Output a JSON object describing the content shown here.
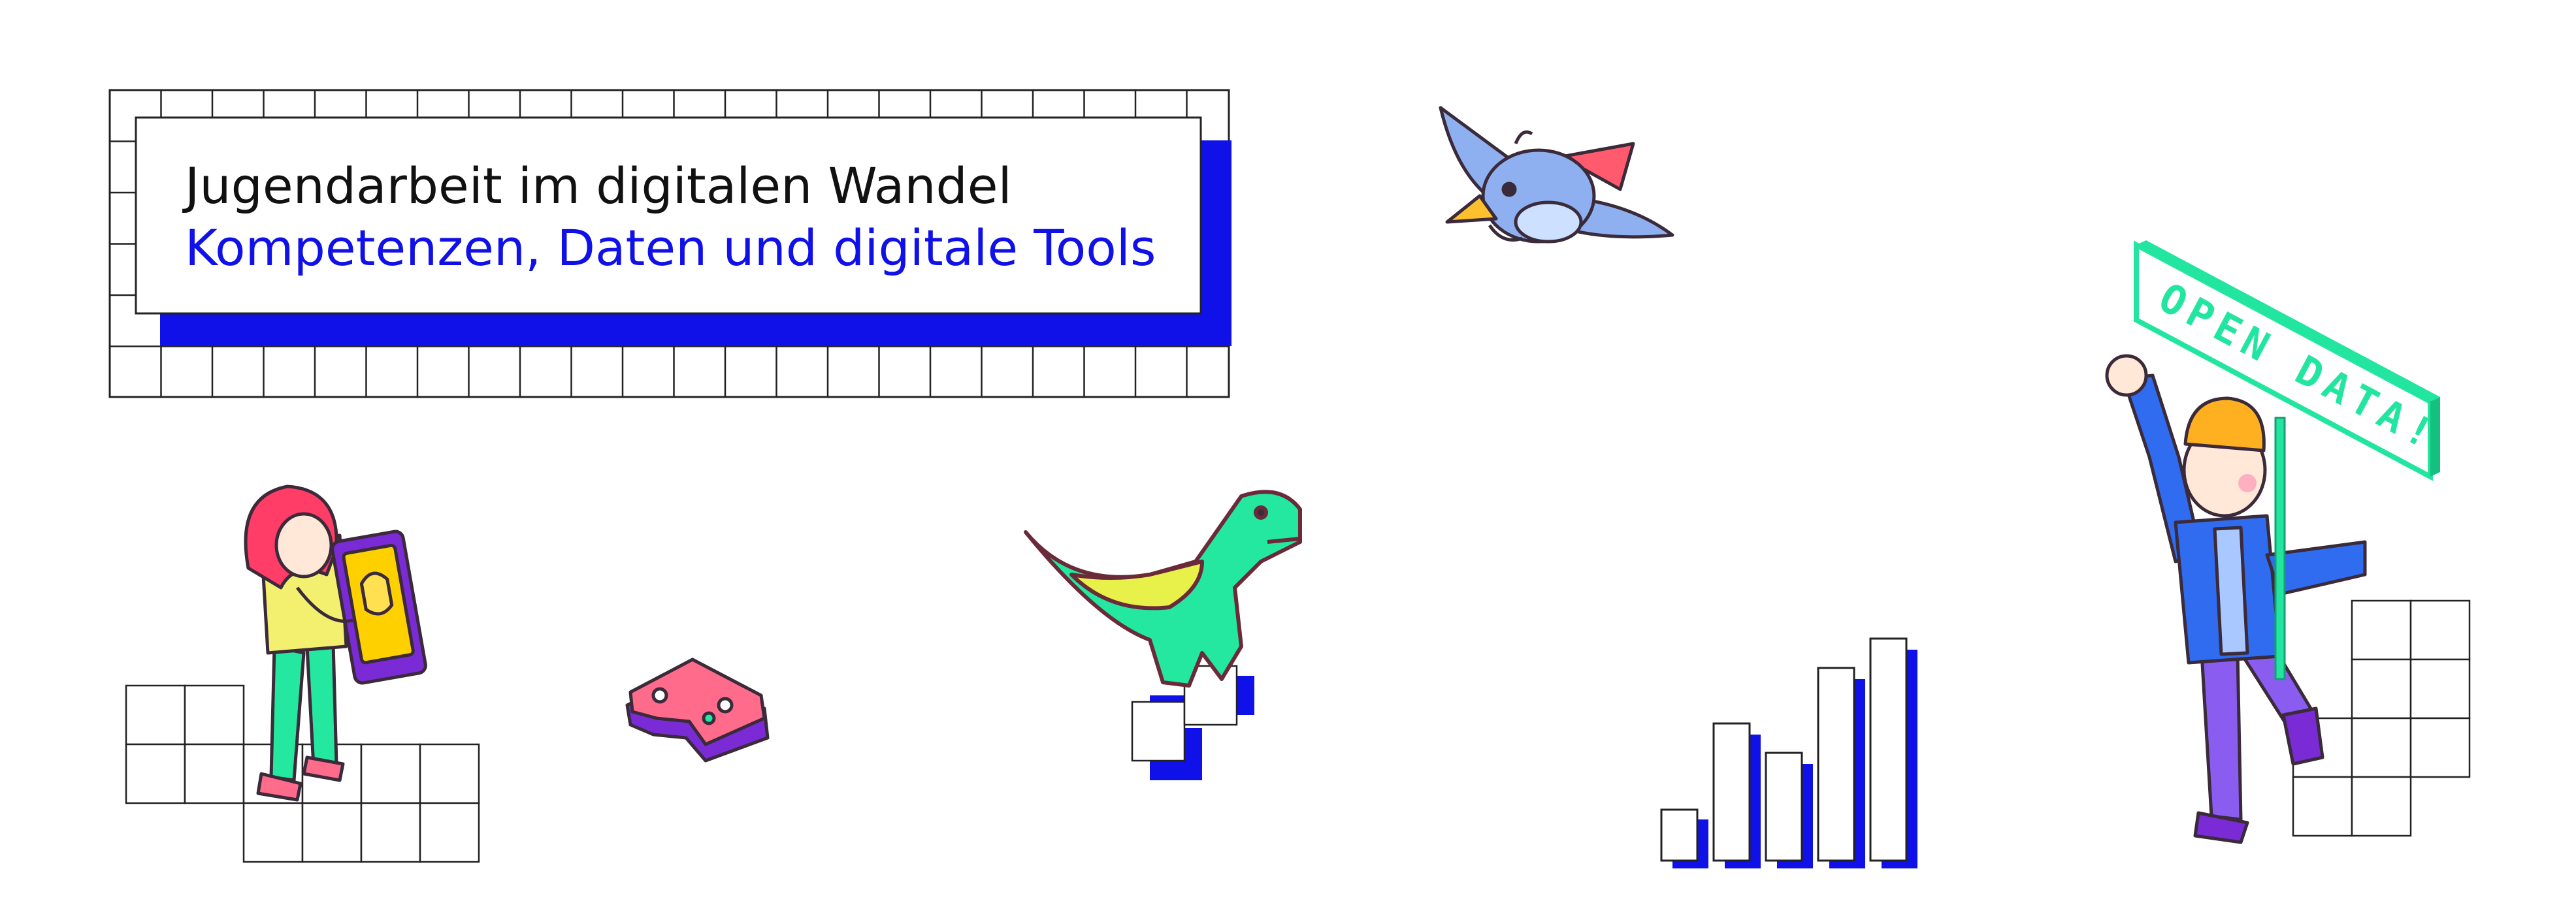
{
  "header": {
    "title": "Jugendarbeit im digitalen Wandel",
    "subtitle": "Kompetenzen, Daten und digitale Tools"
  },
  "sign": {
    "text": "OPEN DATA!"
  },
  "colors": {
    "accent_blue": "#1010e8",
    "outline": "#222222",
    "sign_green": "#22e6a0",
    "dino_green": "#25e8a0",
    "dino_yellow": "#e8f04a",
    "girl_hair": "#ff3d66",
    "bird_blue": "#8fb0f0",
    "controller_pink": "#ff6b8a"
  },
  "icons": [
    "bird-icon",
    "girl-with-tablet-icon",
    "game-controller-icon",
    "dinosaur-icon",
    "bar-chart-icon",
    "person-with-sign-icon"
  ]
}
